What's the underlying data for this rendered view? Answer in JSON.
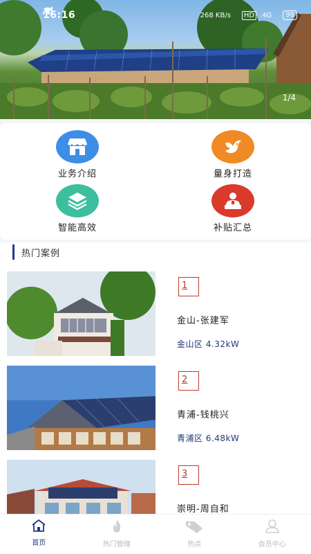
{
  "status_bar": {
    "time": "16:16",
    "speed": "268 KB/s",
    "hd": "HD",
    "signal": "4G",
    "battery": "98"
  },
  "banner": {
    "counter": "1/4"
  },
  "quick_links": [
    {
      "label": "业务介绍",
      "icon": "store-icon",
      "color": "#3d8ee6"
    },
    {
      "label": "量身打造",
      "icon": "bird-icon",
      "color": "#f08a24"
    },
    {
      "label": "智能高效",
      "icon": "layers-icon",
      "color": "#3dbf9f"
    },
    {
      "label": "补贴汇总",
      "icon": "person-podium-icon",
      "color": "#d93a2b"
    }
  ],
  "section": {
    "title": "热门案例"
  },
  "cases": [
    {
      "num": "1",
      "name": "金山-张建军",
      "meta": "金山区 4.32kW"
    },
    {
      "num": "2",
      "name": "青浦-钱桃兴",
      "meta": "青浦区 6.48kW"
    },
    {
      "num": "3",
      "name": "崇明-周自和",
      "meta": ""
    }
  ],
  "bottom_nav": [
    {
      "label": "首页",
      "icon": "home-icon",
      "active": true
    },
    {
      "label": "热门管理",
      "icon": "flame-icon",
      "active": false
    },
    {
      "label": "热点",
      "icon": "tag-icon",
      "active": false
    },
    {
      "label": "会员中心",
      "icon": "user-icon",
      "active": false
    }
  ]
}
